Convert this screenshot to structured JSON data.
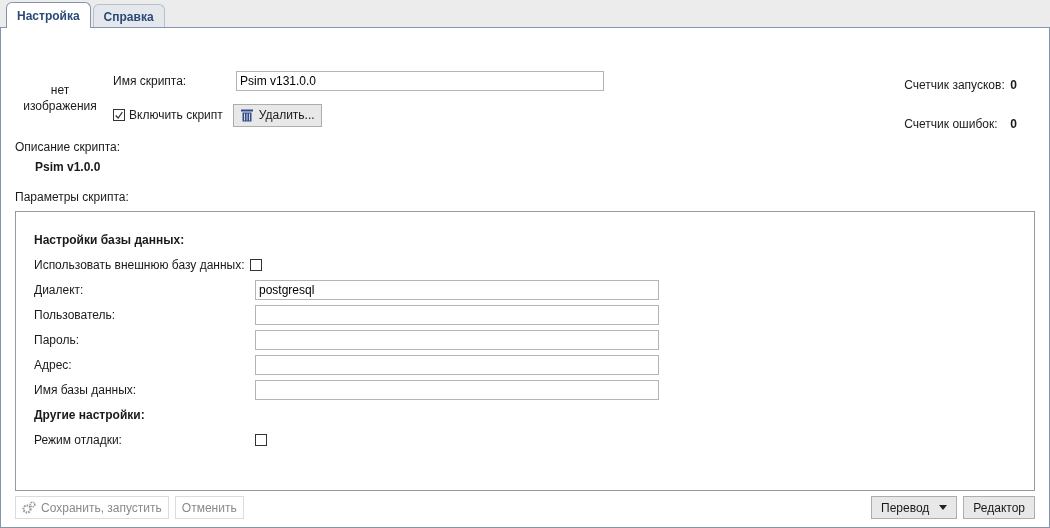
{
  "tabs": [
    {
      "label": "Настройка",
      "selected": true
    },
    {
      "label": "Справка",
      "selected": false
    }
  ],
  "image_placeholder": "нет изображения",
  "script_name": {
    "label": "Имя скрипта:",
    "value": "Psim v131.0.0"
  },
  "enable_script": {
    "label": "Включить скрипт",
    "checked": true
  },
  "delete_button": "Удалить...",
  "counters": [
    {
      "label": "Счетчик запусков:",
      "value": "0"
    },
    {
      "label": "Счетчик ошибок:",
      "value": "0"
    }
  ],
  "description": {
    "label": "Описание скрипта:",
    "value": "Psim v1.0.0"
  },
  "params_label": "Параметры скрипта:",
  "params": [
    {
      "kind": "heading",
      "label": "Настройки базы данных:"
    },
    {
      "kind": "checkbox",
      "label": "Использовать внешнюю базу данных:",
      "checked": false
    },
    {
      "kind": "text",
      "label": "Диалект:",
      "value": "postgresql"
    },
    {
      "kind": "text",
      "label": "Пользователь:"
    },
    {
      "kind": "text",
      "label": "Пароль:"
    },
    {
      "kind": "text",
      "label": "Адрес:"
    },
    {
      "kind": "text",
      "label": "Имя базы данных:"
    },
    {
      "kind": "heading",
      "label": "Другие настройки:"
    },
    {
      "kind": "checkbox2",
      "label": "Режим отладки:",
      "checked": false
    }
  ],
  "footer_left": [
    {
      "label": "Сохранить, запустить",
      "icon": true,
      "disabled": true
    },
    {
      "label": "Отменить",
      "icon": false,
      "disabled": true
    }
  ],
  "footer_right": [
    {
      "label": "Перевод",
      "dropdown": true
    },
    {
      "label": "Редактор",
      "dropdown": false
    }
  ]
}
